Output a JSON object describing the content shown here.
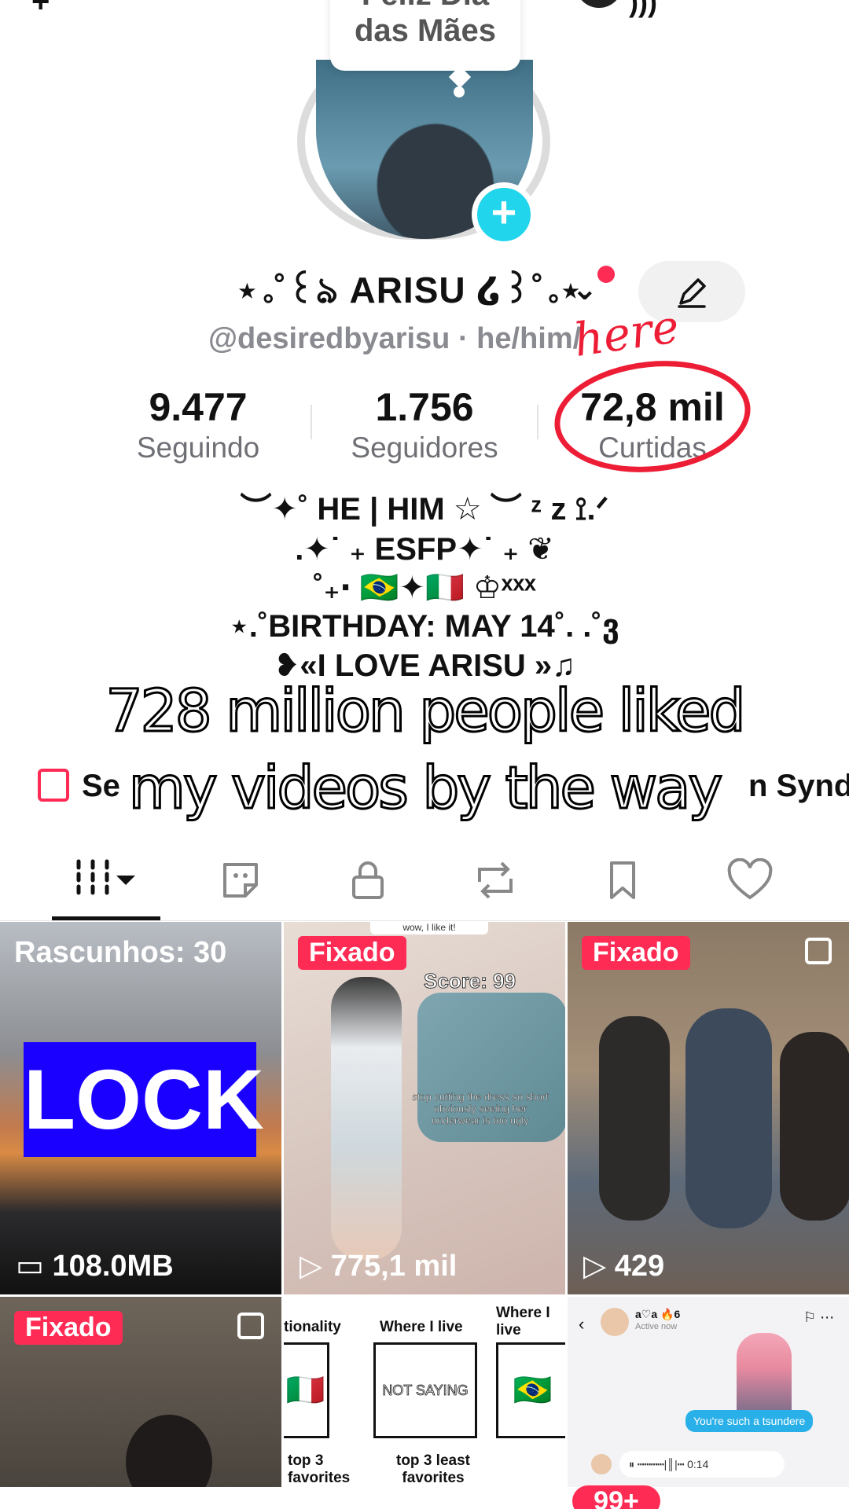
{
  "header": {
    "bubble_line1": "Feliz Dia",
    "bubble_line2": "das Mães"
  },
  "profile": {
    "display_name": "⋆｡˚꒰ঌ ARISU ໒꒱˚｡⋆",
    "handle": "@desiredbyarisu · he/him/",
    "annotation": "here"
  },
  "stats": [
    {
      "value": "9.477",
      "label": "Seguindo"
    },
    {
      "value": "1.756",
      "label": "Seguidores"
    },
    {
      "value": "72,8 mil",
      "label": "Curtidas"
    }
  ],
  "bio": [
    "︶✦˚ HE | HIM ☆ ︶ ᶻ z ⟟.ᐟ",
    ".✦˙ ₊ ESFP✦˙ ₊ ❦",
    "˚₊‧ 🇧🇷✦🇮🇹 ♔ˣˣˣ",
    "⋆.˚BIRTHDAY: MAY 14˚. .˚ვ",
    "❥«I LOVE ARISU »♫"
  ],
  "caption": {
    "line1": "728 million people liked",
    "line2": "my videos by the way"
  },
  "shop_row": {
    "left_text": "Se",
    "right_text": "n Syndro"
  },
  "tabs": [
    "videos",
    "reposts-stickers",
    "private",
    "reposts",
    "saved",
    "liked"
  ],
  "grid": [
    {
      "badge": "Rascunhos: 30",
      "big_text": "LOCK",
      "footer": "108.0MB"
    },
    {
      "pin": "Fixado",
      "score": "Score: 99",
      "caption": "stop cutting the dress so short obviously seeing her underwear is too ugly",
      "top_text": "wow, I like it!",
      "views": "775,1 mil"
    },
    {
      "pin": "Fixado",
      "views": "429"
    },
    {
      "pin": "Fixado"
    },
    {
      "header1": "tionality",
      "header2": "Where I live",
      "header3": "Where I live",
      "box_text": "NOT SAYING",
      "foot1": "top 3 favorites",
      "foot2": "top 3 least favorites"
    },
    {
      "chat_name": "a♡a 🔥6",
      "chat_status": "Active now",
      "message": "You're such a tsundere",
      "duration": "0:14"
    }
  ],
  "bottom": {
    "badge": "99+"
  },
  "colors": {
    "accent": "#fe2c55",
    "cyan": "#20d5ec",
    "muted": "#6f7075"
  }
}
